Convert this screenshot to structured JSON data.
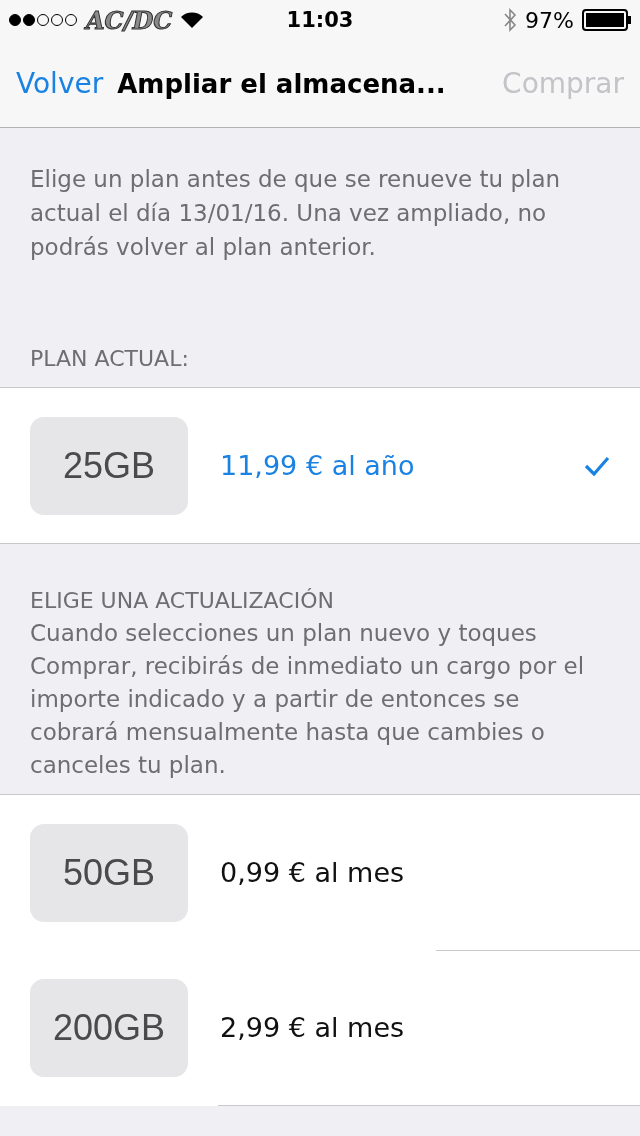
{
  "status_bar": {
    "carrier": "AC/DC",
    "time": "11:03",
    "battery_text": "97%"
  },
  "nav_bar": {
    "back": "Volver",
    "title": "Ampliar el almacena...",
    "action": {
      "label": "Comprar",
      "disabled": true
    }
  },
  "intro": "Elige un plan antes de que se renueve tu plan actual el día 13/01/16.  Una vez ampliado, no podrás volver al plan anterior.",
  "current_section": {
    "header": "PLAN ACTUAL:",
    "plans": [
      {
        "size": "25GB",
        "price": "11,99 € al año",
        "selected": true
      }
    ]
  },
  "upgrade_section": {
    "header": "ELIGE UNA ACTUALIZACIÓN",
    "note": "Cuando selecciones un plan nuevo y toques Comprar, recibirás de inmediato un cargo por el importe indicado y a partir de entonces se cobrará mensualmente hasta que cambies o canceles tu plan.",
    "plans": [
      {
        "size": "50GB",
        "price": "0,99 € al mes",
        "selected": false
      },
      {
        "size": "200GB",
        "price": "2,99 € al mes",
        "selected": false
      }
    ]
  }
}
